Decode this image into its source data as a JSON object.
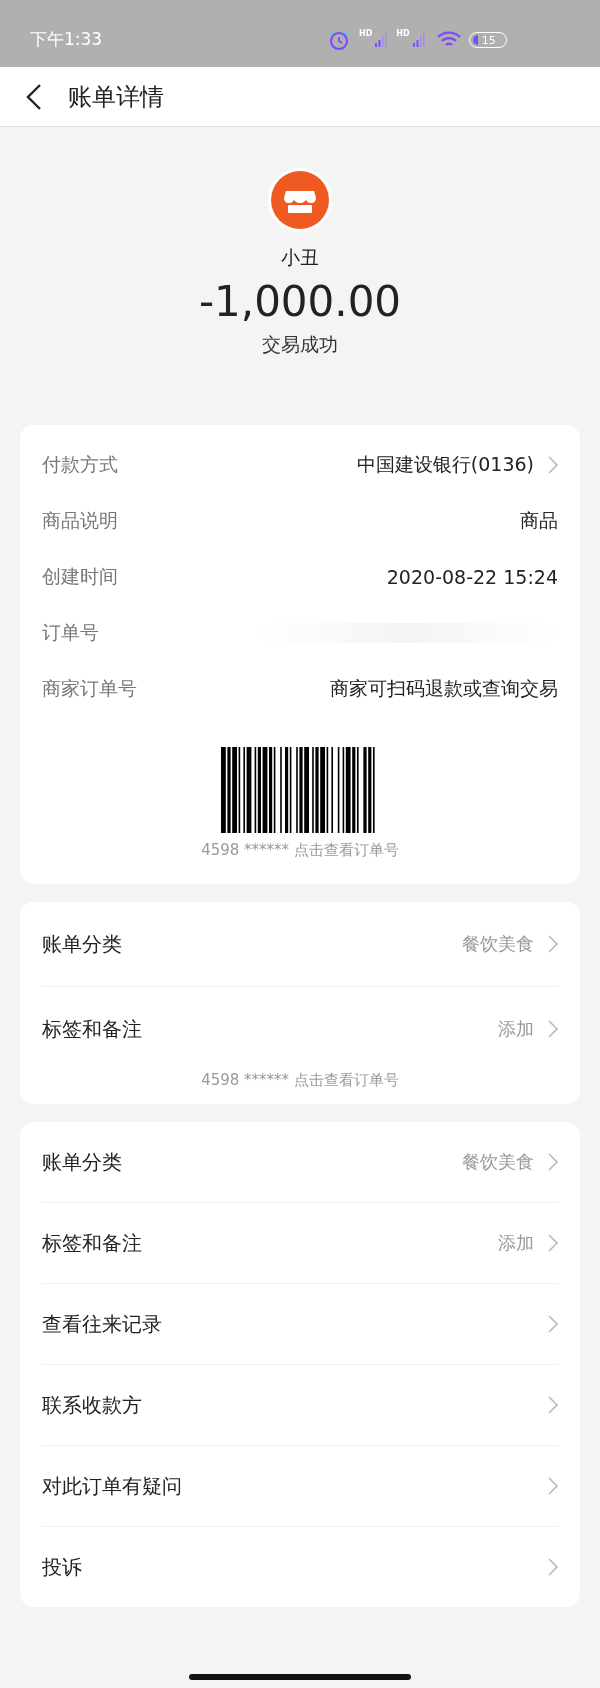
{
  "status_bar": {
    "time": "下午1:33",
    "sim_labels": [
      "HD",
      "HD"
    ],
    "battery": "15"
  },
  "header": {
    "title": "账单详情"
  },
  "merchant": {
    "name": "小丑",
    "amount": "-1,000.00",
    "status": "交易成功"
  },
  "details": {
    "rows": [
      {
        "label": "付款方式",
        "value": "中国建设银行(0136)",
        "chevron": true,
        "kind": "strong"
      },
      {
        "label": "商品说明",
        "value": "商品",
        "chevron": false,
        "kind": "strong"
      },
      {
        "label": "创建时间",
        "value": "2020-08-22 15:24",
        "chevron": false,
        "kind": "strong"
      },
      {
        "label": "订单号",
        "chevron": false,
        "kind": "blurred"
      },
      {
        "label": "商家订单号",
        "value": "商家可扫码退款或查询交易",
        "chevron": false,
        "kind": "strong"
      }
    ],
    "barcode_caption": "4598 ****** 点击查看订单号"
  },
  "category": {
    "rows": [
      {
        "label": "账单分类",
        "value": "餐饮美食",
        "chevron": true
      },
      {
        "label": "标签和备注",
        "value": "添加",
        "chevron": true
      }
    ],
    "caption": "4598 ****** 点击查看订单号"
  },
  "actions": {
    "rows": [
      {
        "label": "账单分类",
        "value": "餐饮美食",
        "chevron": true
      },
      {
        "label": "标签和备注",
        "value": "添加",
        "chevron": true
      },
      {
        "label": "查看往来记录",
        "chevron": true
      },
      {
        "label": "联系收款方",
        "chevron": true
      },
      {
        "label": "对此订单有疑问",
        "chevron": true
      },
      {
        "label": "投诉",
        "chevron": true
      }
    ]
  }
}
